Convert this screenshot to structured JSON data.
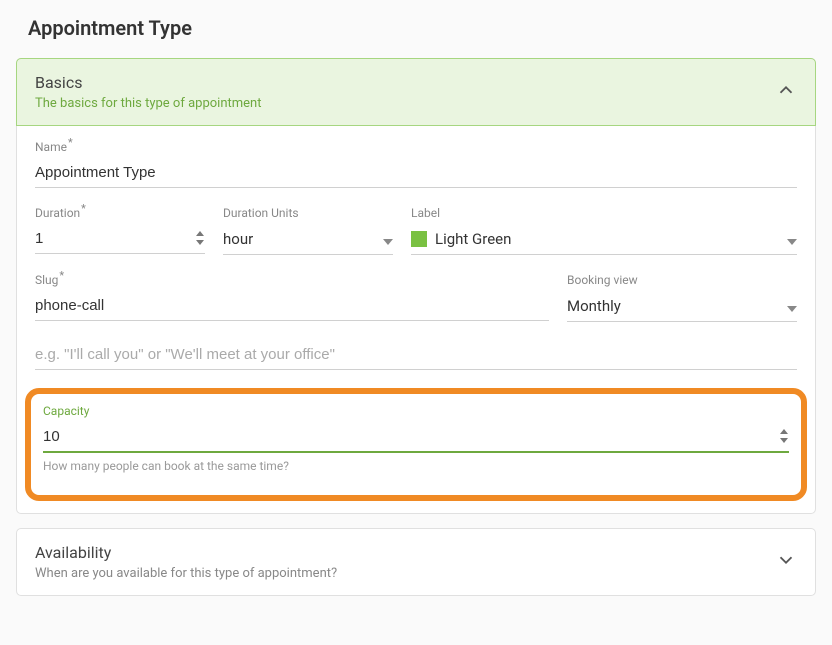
{
  "page": {
    "title": "Appointment Type"
  },
  "basics": {
    "header_title": "Basics",
    "header_subtitle": "The basics for this type of appointment",
    "name": {
      "label": "Name",
      "value": "Appointment Type"
    },
    "duration": {
      "label": "Duration",
      "value": "1"
    },
    "duration_units": {
      "label": "Duration Units",
      "value": "hour"
    },
    "label_field": {
      "label": "Label",
      "value": "Light Green",
      "swatch_color": "#7ac142"
    },
    "slug": {
      "label": "Slug",
      "value": "phone-call"
    },
    "booking_view": {
      "label": "Booking view",
      "value": "Monthly"
    },
    "description": {
      "placeholder": "e.g. \"I'll call you\" or \"We'll meet at your office\""
    },
    "capacity": {
      "label": "Capacity",
      "value": "10",
      "helper": "How many people can book at the same time?"
    }
  },
  "availability": {
    "title": "Availability",
    "subtitle": "When are you available for this type of appointment?"
  }
}
